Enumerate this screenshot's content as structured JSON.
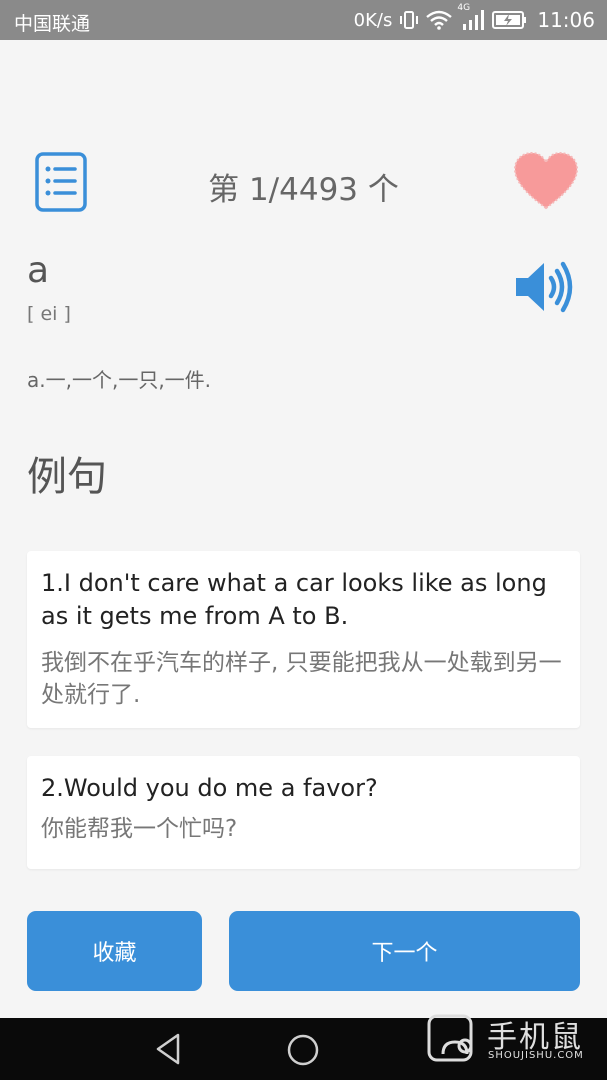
{
  "status_bar": {
    "carrier": "中国联通",
    "speed": "0K/s",
    "network": "4G",
    "time": "11:06"
  },
  "header": {
    "counter": "第 1/4493 个",
    "list_icon": "list-icon",
    "favorite_icon": "heart-icon"
  },
  "word": {
    "text": "a",
    "phonetic": "[ ei ]",
    "definition": "a.一,一个,一只,一件.",
    "speaker_icon": "speaker-icon"
  },
  "examples": {
    "title": "例句",
    "items": [
      {
        "en": "1.I don't care what a car looks like as long as it gets me from A to B.",
        "zh": "我倒不在乎汽车的样子, 只要能把我从一处载到另一处就行了."
      },
      {
        "en": "2.Would you do me a favor?",
        "zh": "你能帮我一个忙吗?"
      }
    ]
  },
  "actions": {
    "favorite_label": "收藏",
    "next_label": "下一个"
  },
  "watermark": {
    "cn": "手机鼠",
    "en": "SHOUJISHU.COM"
  },
  "colors": {
    "accent": "#3a8fd9",
    "heart": "#f79a9a",
    "status_bar": "#8a8a8a",
    "background": "#f5f5f5"
  }
}
